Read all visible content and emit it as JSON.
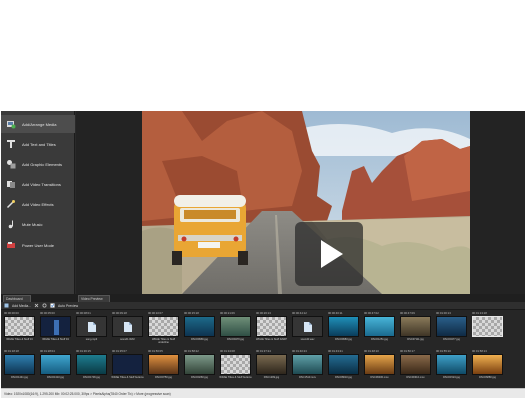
{
  "sidebar": {
    "items": [
      {
        "label": "Add/Arrange Media",
        "icon": "media-file-icon",
        "active": true
      },
      {
        "label": "Add Text and Titles",
        "icon": "text-icon",
        "active": false
      },
      {
        "label": "Add Graphic Elements",
        "icon": "shapes-icon",
        "active": false
      },
      {
        "label": "Add Video Transitions",
        "icon": "transitions-icon",
        "active": false
      },
      {
        "label": "Add Video Effects",
        "icon": "effects-icon",
        "active": false
      },
      {
        "label": "Mute Music",
        "icon": "music-icon",
        "active": false
      },
      {
        "label": "Power User Mode",
        "icon": "power-user-icon",
        "active": false
      }
    ]
  },
  "tabs": [
    {
      "label": "Dashboard"
    },
    {
      "label": "Video Preview"
    }
  ],
  "toolbar": {
    "add_media_label": "Add Media...",
    "auto_preview_label": "Auto Preview"
  },
  "media": {
    "row1": [
      {
        "time": "00:00:00:00",
        "name": "WDAE Titles & Stuff 16",
        "type": "checker"
      },
      {
        "time": "00:00:05:00",
        "name": "WDAE Titles & Stuff 04",
        "type": "navy"
      },
      {
        "time": "00:00:08:01",
        "name": "song.mp3",
        "type": "audio"
      },
      {
        "time": "00:00:09:18",
        "name": "sound1.WAV",
        "type": "audio"
      },
      {
        "time": "00:00:10:07",
        "name": "WDAE Titles & Stuff underline",
        "type": "checker"
      },
      {
        "time": "00:00:15:18",
        "name": "DSC09966.jpg",
        "type": "teal"
      },
      {
        "time": "00:00:21:06",
        "name": "DSC09470.jpg",
        "type": "scenic"
      },
      {
        "time": "00:00:26:13",
        "name": "WDAE Titles & Stuff DARP",
        "type": "checker"
      },
      {
        "time": "00:00:44:12",
        "name": "sound2.wav",
        "type": "audio"
      },
      {
        "time": "00:00:46:11",
        "name": "DSC09983.jpg",
        "type": "ocean"
      },
      {
        "time": "00:00:47:02",
        "name": "DSC01251.jpg",
        "type": "aqua"
      },
      {
        "time": "00:00:47:09",
        "name": "DSC07111.jpg",
        "type": "brown"
      },
      {
        "time": "00:01:00:13",
        "name": "DSC00477.jpg",
        "type": "sea"
      },
      {
        "time": "00:01:13:18",
        "name": "",
        "type": "checker-selected"
      }
    ],
    "row2": [
      {
        "time": "00:01:18:18",
        "name": "DSC01441.jpg",
        "type": "ocean"
      },
      {
        "time": "00:01:28:04",
        "name": "DSC01310.jpg",
        "type": "aqua"
      },
      {
        "time": "00:01:36:15",
        "name": "DSC01736.jpg",
        "type": "teal"
      },
      {
        "time": "00:01:35:07",
        "name": "WDAE Titles & Stuff buttons",
        "type": "navy"
      },
      {
        "time": "00:01:56:05",
        "name": "DSC00750.jpg",
        "type": "sunset"
      },
      {
        "time": "00:01:58:22",
        "name": "DSC00260.jpg",
        "type": "scenic"
      },
      {
        "time": "00:01:34:08",
        "name": "WDAE Titles & Stuff buttons",
        "type": "checker"
      },
      {
        "time": "00:01:37:24",
        "name": "DSC1299.jpg",
        "type": "brown"
      },
      {
        "time": "00:01:40:23",
        "name": "DSC1510.mov",
        "type": "teal"
      },
      {
        "time": "00:01:43:21",
        "name": "DSC08010.jpg",
        "type": "ocean"
      },
      {
        "time": "00:01:48:10",
        "name": "DSC06030.mov",
        "type": "sunset"
      },
      {
        "time": "00:01:50:17",
        "name": "DSC00310.mov",
        "type": "brown"
      },
      {
        "time": "00:01:55:10",
        "name": "DSC01524.jpg",
        "type": "aqua"
      },
      {
        "time": "00:01:58:13",
        "name": "DSC06880.jpg",
        "type": "sunset"
      }
    ]
  },
  "status_text": "Video: 1920x1080(16:9), 1.295.200 Mb: 00:02:25.000, 30fps > PixelsAlpha(7840 Order Tix) > More (progressive scan)"
}
